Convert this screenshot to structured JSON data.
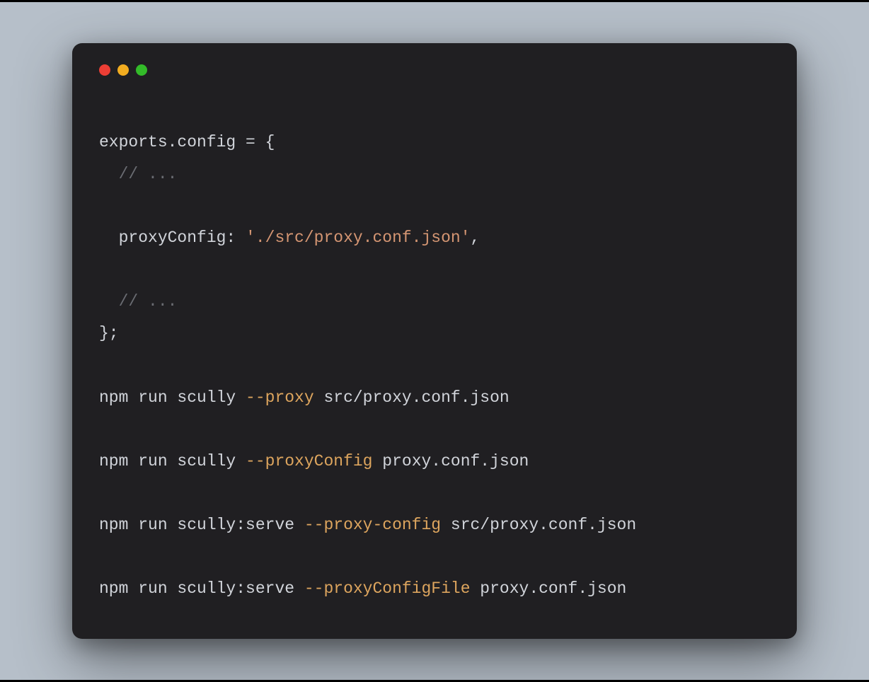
{
  "window": {
    "controls": {
      "red": "close",
      "yellow": "minimize",
      "green": "maximize"
    }
  },
  "code": {
    "line1": {
      "text": "exports.config = {"
    },
    "line2": {
      "indent": "  ",
      "comment": "// ..."
    },
    "line3": {
      "blank": ""
    },
    "line4": {
      "indent": "  ",
      "property": "proxyConfig: ",
      "string": "'./src/proxy.conf.json'",
      "after": ","
    },
    "line5": {
      "blank": ""
    },
    "line6": {
      "indent": "  ",
      "comment": "// ..."
    },
    "line7": {
      "text": "};"
    },
    "line8": {
      "blank": ""
    },
    "line9": {
      "cmd_pre": "npm run scully ",
      "flag": "--proxy",
      "cmd_post": " src/proxy.conf.json"
    },
    "line10": {
      "blank": ""
    },
    "line11": {
      "cmd_pre": "npm run scully ",
      "flag": "--proxyConfig",
      "cmd_post": " proxy.conf.json"
    },
    "line12": {
      "blank": ""
    },
    "line13": {
      "cmd_pre": "npm run scully:serve ",
      "flag": "--proxy-config",
      "cmd_post": " src/proxy.conf.json"
    },
    "line14": {
      "blank": ""
    },
    "line15": {
      "cmd_pre": "npm run scully:serve ",
      "flag": "--proxyConfigFile",
      "cmd_post": " proxy.conf.json"
    }
  }
}
